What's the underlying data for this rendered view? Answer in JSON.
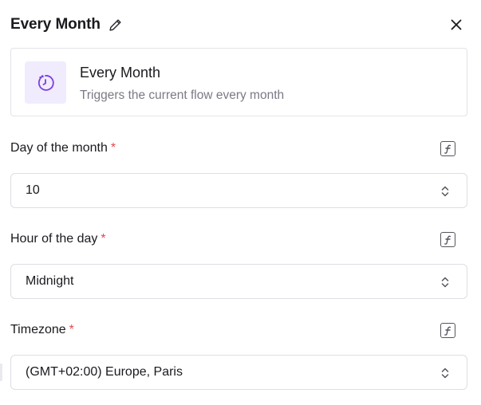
{
  "header": {
    "title": "Every Month"
  },
  "trigger": {
    "title": "Every Month",
    "description": "Triggers the current flow every month",
    "accent_color": "#7b3fe4",
    "icon_bg_color": "#f0ecfd"
  },
  "fields": [
    {
      "label": "Day of the month",
      "required_mark": "*",
      "value": "10"
    },
    {
      "label": "Hour of the day",
      "required_mark": "*",
      "value": "Midnight"
    },
    {
      "label": "Timezone",
      "required_mark": "*",
      "value": "(GMT+02:00) Europe, Paris"
    }
  ],
  "icons": {
    "edit": "pencil-icon",
    "close": "close-icon",
    "trigger": "clock-icon",
    "formula": "formula-icon",
    "select": "chevron-updown-icon"
  },
  "colors": {
    "required": "#e5484d",
    "border": "#dedee4",
    "muted_text": "#7a7a85"
  }
}
